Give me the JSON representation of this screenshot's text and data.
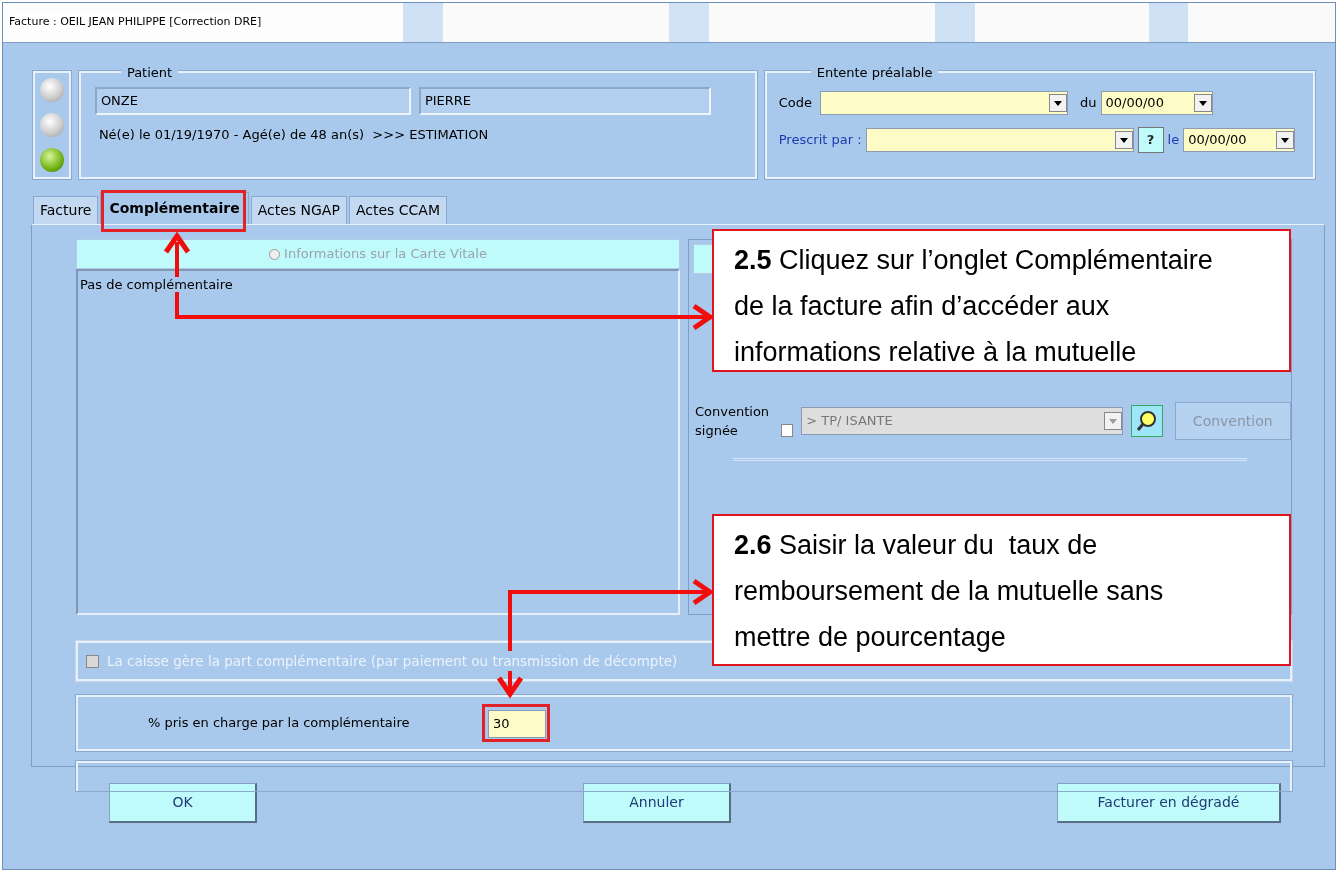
{
  "window": {
    "title": "Facture : OEIL JEAN PHILIPPE [Correction DRE]"
  },
  "status_lights": [
    {
      "on": false
    },
    {
      "on": false
    },
    {
      "on": true
    }
  ],
  "patient": {
    "legend": "Patient",
    "last_name": "ONZE",
    "first_name": "PIERRE",
    "info": "Né(e) le 01/19/1970 - Agé(e) de 48 an(s)  >>> ESTIMATION"
  },
  "entente": {
    "legend": "Entente préalable",
    "code_label": "Code",
    "du_label": "du",
    "du_value": "00/00/00",
    "prescrit_label": "Prescrit par :",
    "help_button": "?",
    "le_label": "le",
    "le_value": "00/00/00"
  },
  "tabs": [
    {
      "label": "Facture",
      "selected": false
    },
    {
      "label": "Complémentaire",
      "selected": true
    },
    {
      "label": "Actes NGAP",
      "selected": false
    },
    {
      "label": "Actes CCAM",
      "selected": false
    }
  ],
  "carte_vitale": {
    "label": "Informations sur la Carte Vitale",
    "selected": false,
    "disabled": true
  },
  "list_text": "Pas de complémentaire",
  "convention": {
    "label": "Convention signée",
    "checked": false,
    "value": "> TP/ ISANTE",
    "disabled": true,
    "button": "Convention"
  },
  "caisse_checkbox": {
    "label": "La caisse gère la part complémentaire (par paiement ou transmission de décompte)",
    "checked": false,
    "disabled": true
  },
  "taux": {
    "label": "% pris en charge par la complémentaire",
    "value": "30"
  },
  "buttons": [
    "OK",
    "Annuler",
    "Facturer en dégradé"
  ],
  "annotations": [
    {
      "text": "**2.5** Cliquez sur l’onglet Complémentaire de la facture afin d’accéder aux informations relative à la mutuelle"
    },
    {
      "text": "**2.6** Saisir la valeur du  taux de remboursement de la mutuelle sans mettre de pourcentage"
    }
  ]
}
